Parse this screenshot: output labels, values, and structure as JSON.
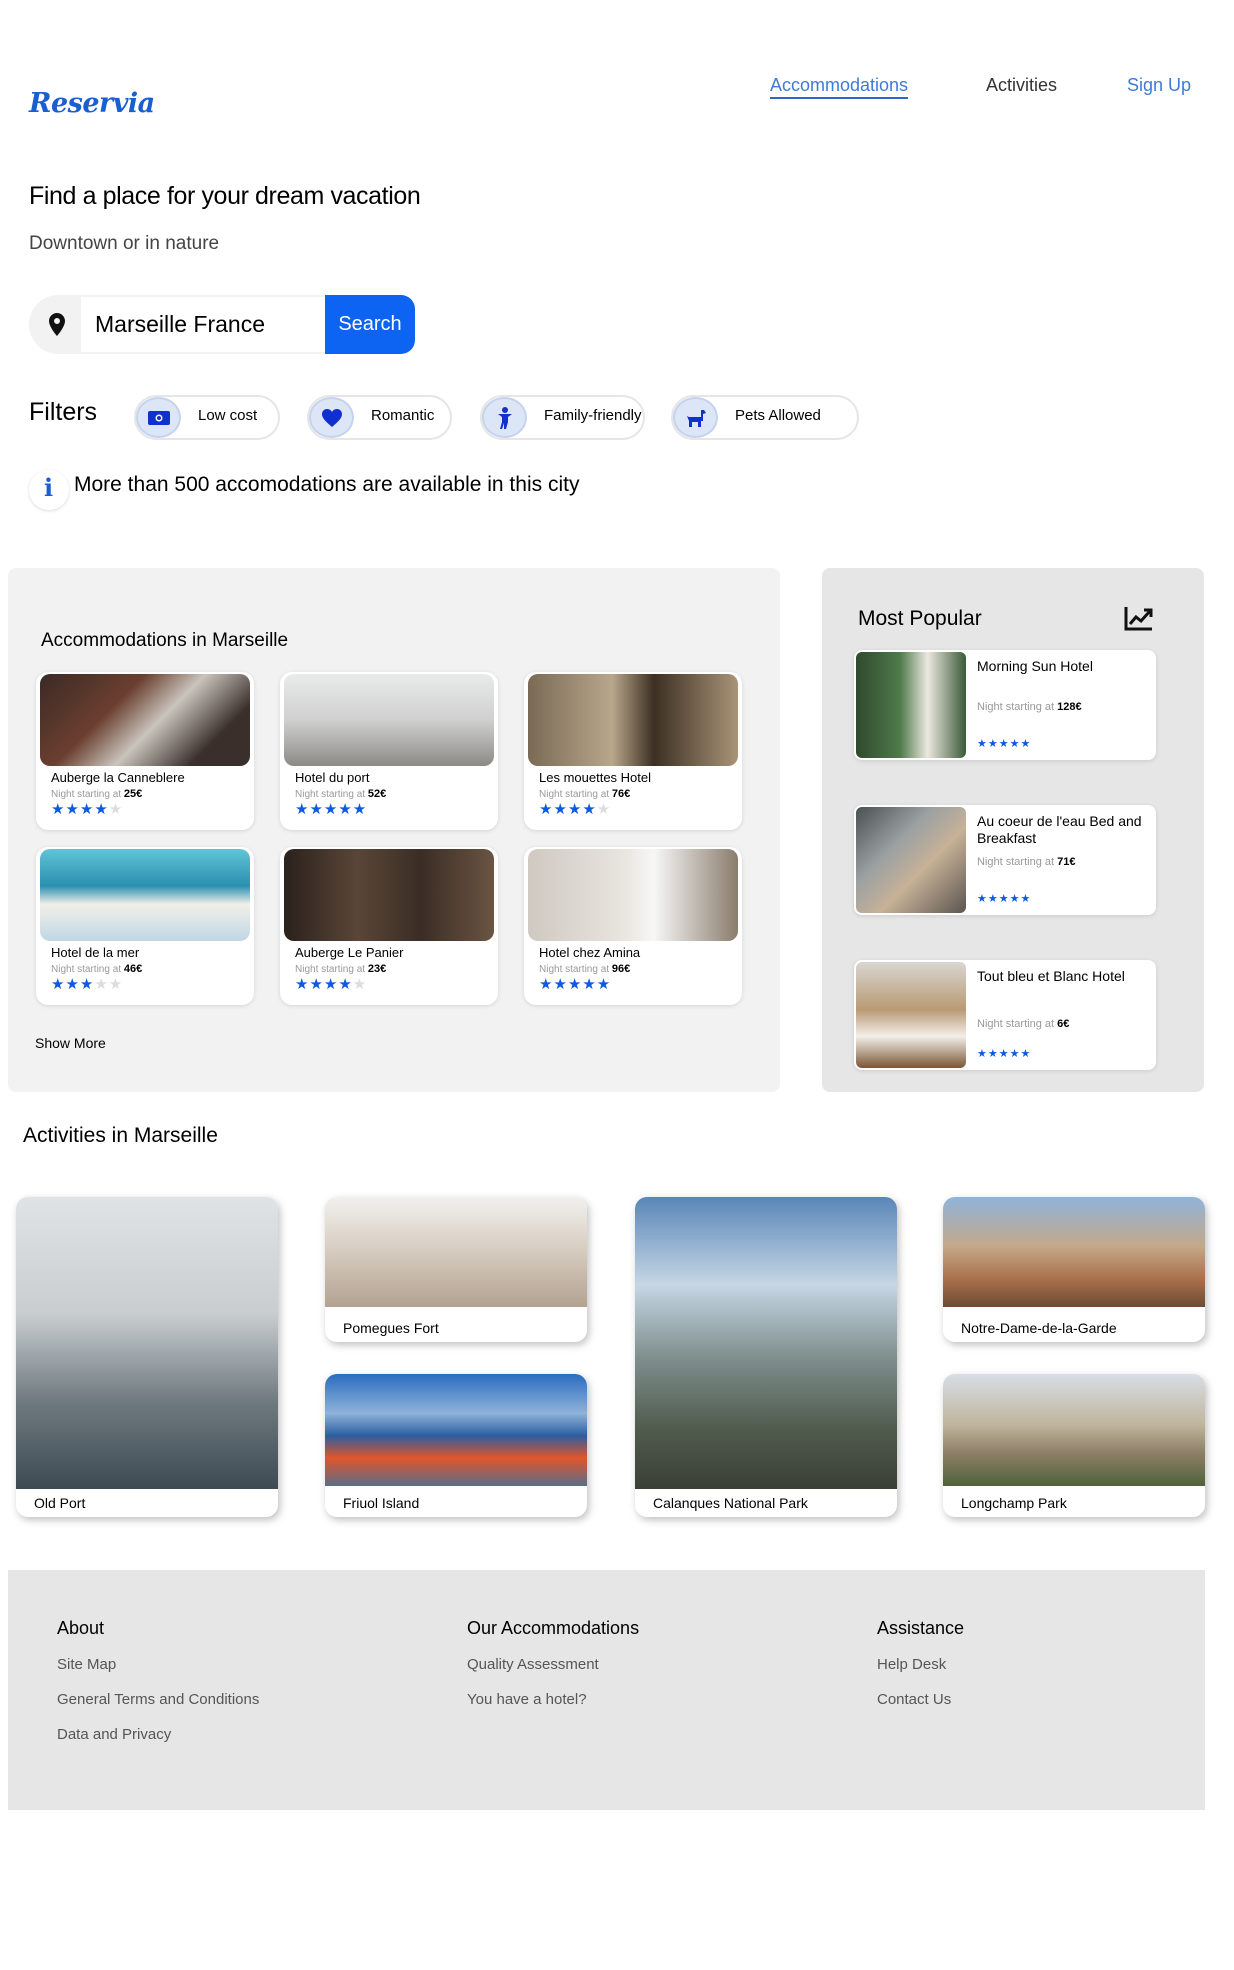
{
  "brand": {
    "logo": "Reservia"
  },
  "nav": {
    "accommodations": "Accommodations",
    "activities": "Activities",
    "signup": "Sign Up"
  },
  "hero": {
    "title": "Find a place for your dream vacation",
    "subtitle": "Downtown or in nature",
    "search_value": "Marseille France",
    "search_button": "Search"
  },
  "filters": {
    "label": "Filters",
    "items": [
      {
        "label": "Low cost",
        "icon": "money-icon"
      },
      {
        "label": "Romantic",
        "icon": "heart-icon"
      },
      {
        "label": "Family-friendly",
        "icon": "child-icon"
      },
      {
        "label": "Pets Allowed",
        "icon": "dog-icon"
      }
    ]
  },
  "info": {
    "text": "More than 500 accomodations are available in this city",
    "icon": "i"
  },
  "accommodations": {
    "title": "Accommodations in Marseille",
    "price_prefix": "Night starting at",
    "show_more": "Show More",
    "items": [
      {
        "name": "Auberge la Canneblere",
        "price": "25€",
        "rating": 4
      },
      {
        "name": "Hotel du port",
        "price": "52€",
        "rating": 5
      },
      {
        "name": "Les mouettes Hotel",
        "price": "76€",
        "rating": 4
      },
      {
        "name": "Hotel de la mer",
        "price": "46€",
        "rating": 3
      },
      {
        "name": "Auberge Le Panier",
        "price": "23€",
        "rating": 4
      },
      {
        "name": "Hotel chez Amina",
        "price": "96€",
        "rating": 5
      }
    ]
  },
  "popular": {
    "title": "Most Popular",
    "price_prefix": "Night starting at",
    "items": [
      {
        "name": "Morning Sun Hotel",
        "price": "128€",
        "rating": 5
      },
      {
        "name": "Au coeur de l'eau Bed and Breakfast",
        "price": "71€",
        "rating": 5
      },
      {
        "name": "Tout bleu et Blanc Hotel",
        "price": "6€",
        "rating": 5
      }
    ]
  },
  "activities": {
    "title": "Activities in Marseille",
    "items": [
      {
        "label": "Old Port"
      },
      {
        "label": "Pomegues Fort"
      },
      {
        "label": "Friuol Island"
      },
      {
        "label": "Calanques National Park"
      },
      {
        "label": "Notre-Dame-de-la-Garde"
      },
      {
        "label": "Longchamp Park"
      }
    ]
  },
  "footer": {
    "about": {
      "title": "About",
      "links": [
        "Site Map",
        "General Terms and Conditions",
        "Data and Privacy"
      ]
    },
    "accommodations": {
      "title": "Our Accommodations",
      "links": [
        "Quality Assessment",
        "You have a hotel?"
      ]
    },
    "assistance": {
      "title": "Assistance",
      "links": [
        "Help Desk",
        "Contact Us"
      ]
    }
  },
  "colors": {
    "brand": "#1a5fd0",
    "accent": "#0d64f2",
    "panel": "#f2f2f2",
    "panel_dark": "#e6e6e6",
    "star": "#0d5ae0"
  }
}
